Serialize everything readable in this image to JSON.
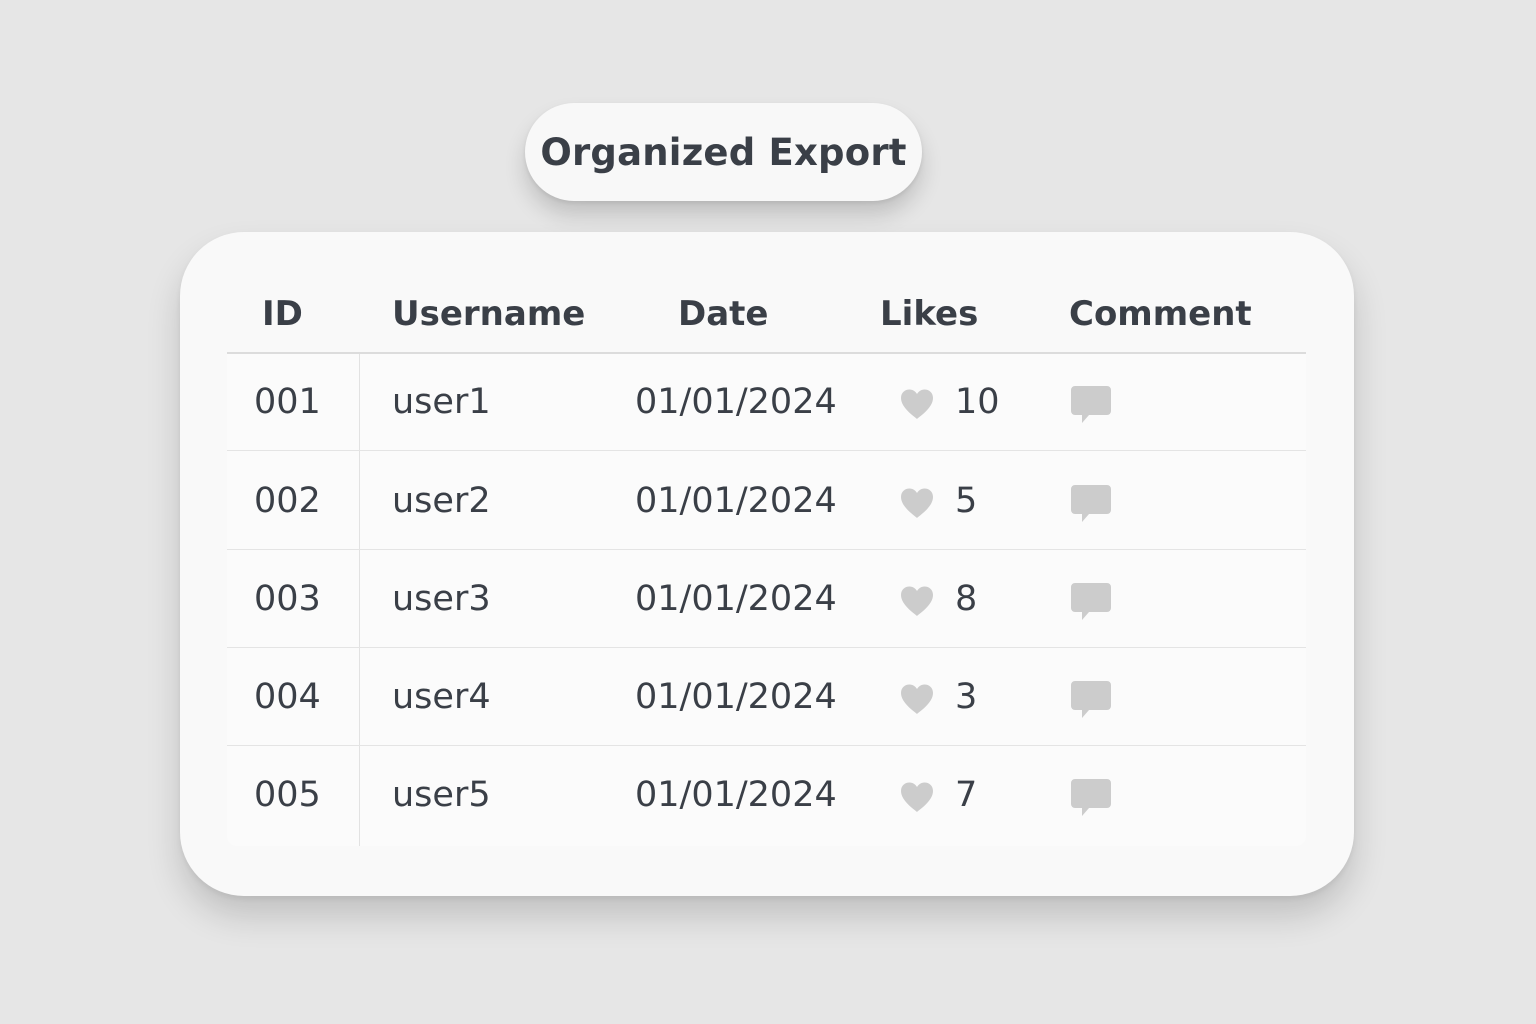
{
  "title": "Organized Export",
  "table": {
    "headers": {
      "id": "ID",
      "username": "Username",
      "date": "Date",
      "likes": "Likes",
      "comment": "Comment"
    },
    "rows": [
      {
        "id": "001",
        "username": "user1",
        "date": "01/01/2024",
        "likes": "10",
        "comment_icon": "comment-bubble-icon"
      },
      {
        "id": "002",
        "username": "user2",
        "date": "01/01/2024",
        "likes": "5",
        "comment_icon": "comment-bubble-icon"
      },
      {
        "id": "003",
        "username": "user3",
        "date": "01/01/2024",
        "likes": "8",
        "comment_icon": "comment-bubble-icon"
      },
      {
        "id": "004",
        "username": "user4",
        "date": "01/01/2024",
        "likes": "3",
        "comment_icon": "comment-bubble-icon"
      },
      {
        "id": "005",
        "username": "user5",
        "date": "01/01/2024",
        "likes": "7",
        "comment_icon": "comment-bubble-icon"
      }
    ]
  },
  "icons": {
    "likes": "heart-icon",
    "comment": "comment-bubble-icon"
  },
  "colors": {
    "background": "#e6e6e6",
    "card": "#f9f9f9",
    "text": "#3a3f47",
    "icon": "#cccccc"
  }
}
